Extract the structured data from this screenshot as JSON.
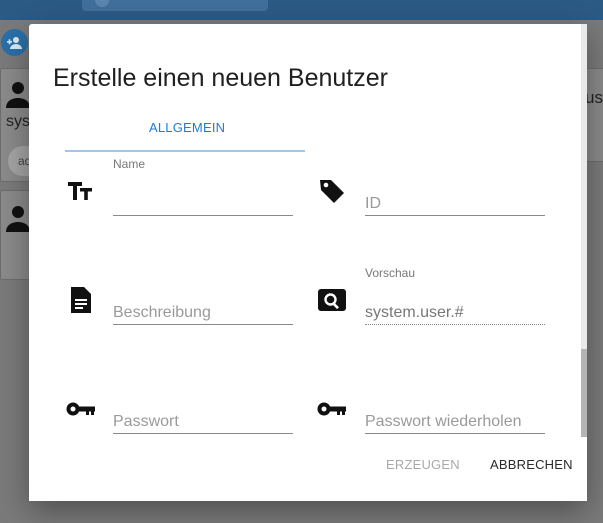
{
  "background": {
    "sidebar_text": "sys",
    "chip_text": "ad",
    "right_text": "us"
  },
  "dialog": {
    "title": "Erstelle einen neuen Benutzer",
    "tabs": [
      {
        "label": "ALLGEMEIN",
        "active": true
      }
    ],
    "fields": {
      "name": {
        "label": "Name",
        "value": "",
        "icon": "text-format-icon"
      },
      "id": {
        "placeholder": "ID",
        "icon": "tag-icon"
      },
      "description": {
        "placeholder": "Beschreibung",
        "icon": "document-icon"
      },
      "preview": {
        "label": "Vorschau",
        "value": "system.user.#",
        "icon": "search-preview-icon"
      },
      "password": {
        "placeholder": "Passwort",
        "icon": "key-icon"
      },
      "password_repeat": {
        "placeholder": "Passwort wiederholen",
        "icon": "key-icon"
      }
    },
    "buttons": {
      "create": "ERZEUGEN",
      "cancel": "ABBRECHEN"
    }
  },
  "colors": {
    "accent": "#1f7dd1",
    "tab_indicator": "#9ec7ea",
    "header": "#2b5a85"
  }
}
